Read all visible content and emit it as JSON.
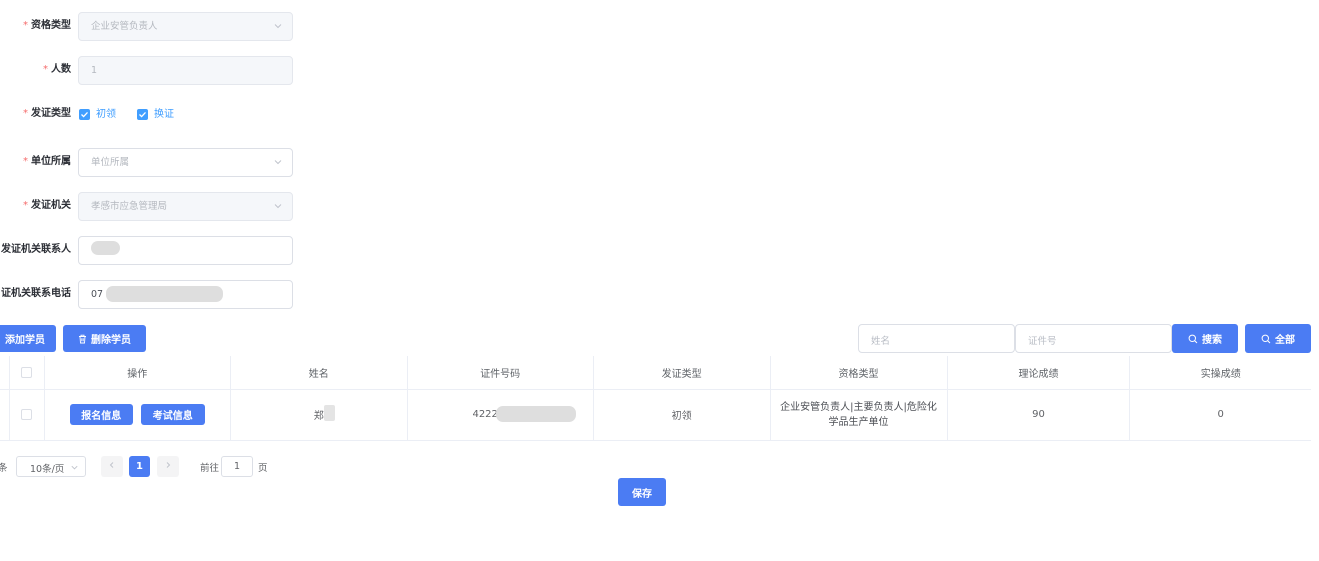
{
  "form": {
    "qualification_type": {
      "label": "资格类型",
      "value": "企业安管负责人"
    },
    "headcount": {
      "label": "人数",
      "value": "1"
    },
    "cert_issue_type": {
      "label": "发证类型",
      "options": [
        "初领",
        "换证"
      ]
    },
    "affiliation": {
      "label": "单位所属",
      "placeholder": "单位所属"
    },
    "issuing_authority": {
      "label": "发证机关",
      "value": "孝感市应急管理局"
    },
    "authority_contact": {
      "label": "发证机关联系人"
    },
    "authority_phone": {
      "label": "证机关联系电话",
      "value_prefix": "07"
    }
  },
  "toolbar": {
    "add_student": "添加学员",
    "delete_student": "删除学员",
    "name_placeholder": "姓名",
    "idno_placeholder": "证件号",
    "search": "搜索",
    "all": "全部"
  },
  "table": {
    "headers": [
      "操作",
      "姓名",
      "证件号码",
      "发证类型",
      "资格类型",
      "理论成绩",
      "实操成绩"
    ],
    "rows": [
      {
        "actions": [
          "报名信息",
          "考试信息"
        ],
        "name": "郑",
        "id_number": "4222",
        "issue_type": "初领",
        "qualification": "企业安管负责人|主要负责人|危险化学品生产单位",
        "theory_score": "90",
        "practical_score": "0"
      }
    ]
  },
  "pagination": {
    "total_suffix": "条",
    "page_size": "10条/页",
    "current_page": "1",
    "goto_prefix": "前往",
    "goto_value": "1",
    "goto_suffix": "页"
  },
  "save_button": "保存",
  "colors": {
    "primary": "#4b7cf3",
    "checkbox": "#409eff",
    "required": "#f56c6c"
  }
}
